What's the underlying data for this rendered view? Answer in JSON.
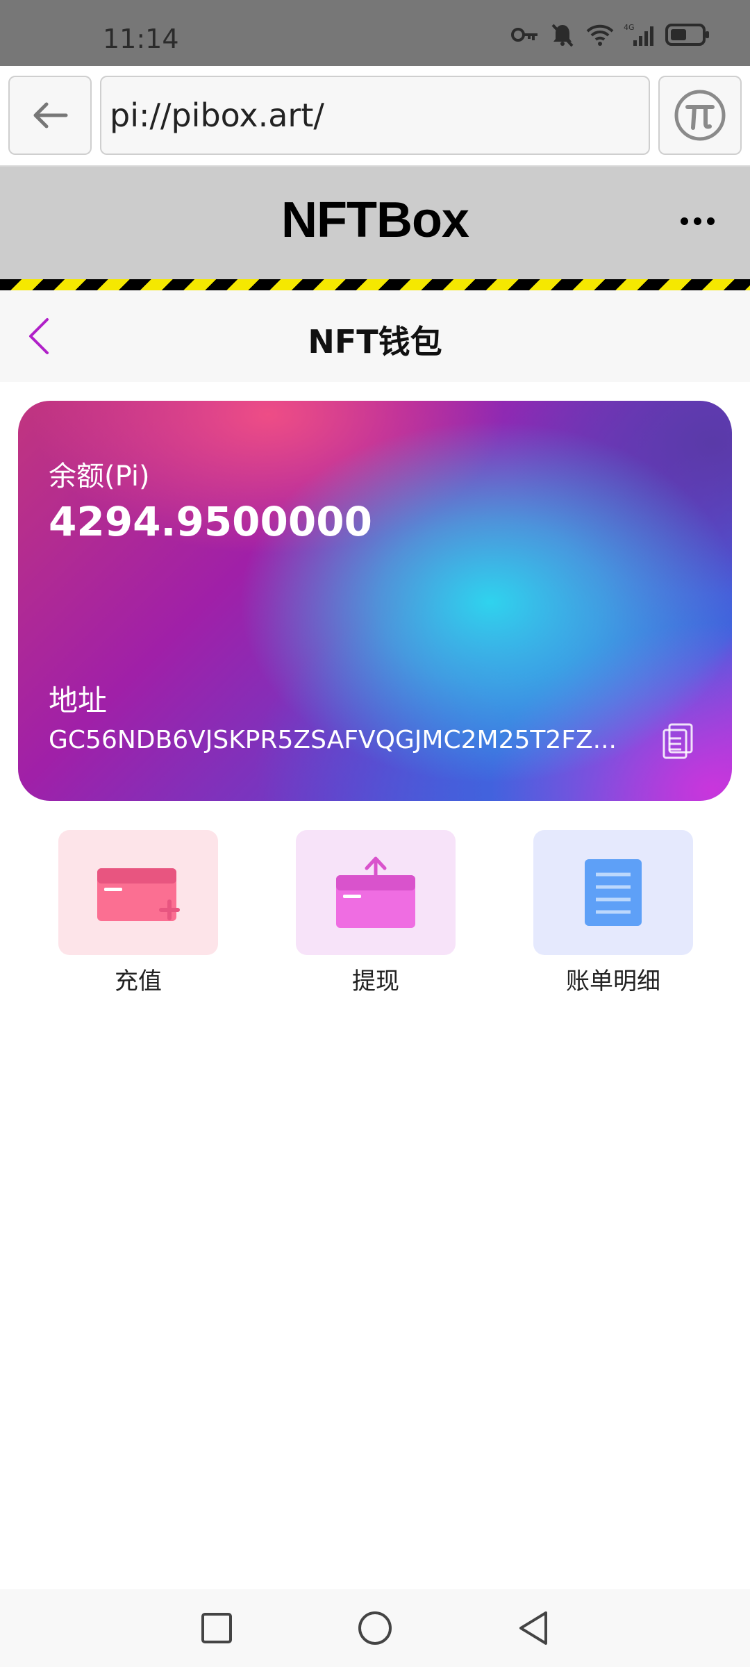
{
  "status_bar": {
    "time": "11:14",
    "icons": [
      "key-icon",
      "bell-muted-icon",
      "wifi-icon",
      "signal-4g-icon",
      "battery-icon"
    ],
    "network_label": "4G"
  },
  "browser": {
    "url": "pi://pibox.art/",
    "back_icon": "arrow-left-icon",
    "pi_icon": "pi-logo-icon"
  },
  "app_header": {
    "title": "NFTBox",
    "more_icon": "more-horizontal-icon"
  },
  "page": {
    "title": "NFT钱包",
    "back_icon": "chevron-left-icon"
  },
  "wallet": {
    "balance_label": "余额(Pi)",
    "balance_value": "4294.9500000",
    "address_label": "地址",
    "address_value": "GC56NDB6VJSKPR5ZSAFVQGJMC2M25T2FZ...",
    "copy_icon": "copy-icon"
  },
  "actions": [
    {
      "label": "充值",
      "icon": "card-add-icon",
      "color": "#fb6f92"
    },
    {
      "label": "提现",
      "icon": "card-withdraw-icon",
      "color": "#ef6de2"
    },
    {
      "label": "账单明细",
      "icon": "document-list-icon",
      "color": "#5ea0f7"
    }
  ],
  "nav_bar": {
    "icons": [
      "recent-apps-icon",
      "home-icon",
      "back-icon"
    ]
  },
  "colors": {
    "status_bar_bg": "#777777",
    "header_bg": "#cccccc",
    "hazard_yellow": "#f5e800",
    "accent_purple": "#b020c8"
  }
}
